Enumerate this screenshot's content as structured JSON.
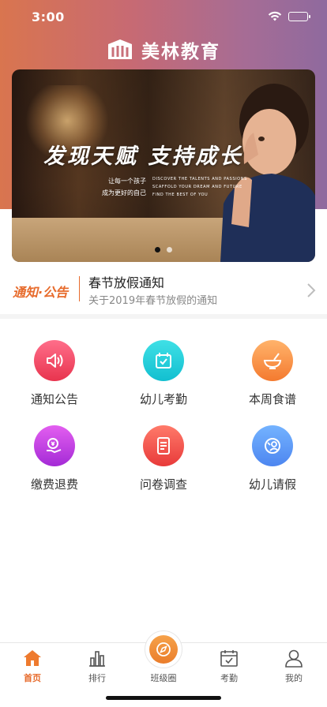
{
  "status_bar": {
    "time": "3:00"
  },
  "brand": {
    "name": "美林教育"
  },
  "banner": {
    "title": "发现天赋 支持成长",
    "subtitle_cn": [
      "让每一个孩子",
      "成为更好的自己"
    ],
    "subtitle_en": [
      "DISCOVER THE TALENTS AND PASSIONS",
      "SCAFFOLD YOUR DREAM AND FUTURE",
      "FIND THE BEST OF YOU"
    ],
    "page_count": 2,
    "active_page": 1
  },
  "notice": {
    "label": "通知·公告",
    "title": "春节放假通知",
    "description": "关于2019年春节放假的通知"
  },
  "features": [
    {
      "label": "通知公告",
      "icon": "speaker-icon",
      "color_from": "#ff6e8a",
      "color_to": "#e8344e"
    },
    {
      "label": "幼儿考勤",
      "icon": "calendar-check-icon",
      "color_from": "#3fe0e6",
      "color_to": "#12bfd0"
    },
    {
      "label": "本周食谱",
      "icon": "bowl-icon",
      "color_from": "#ffb36b",
      "color_to": "#f47a2f"
    },
    {
      "label": "缴费退费",
      "icon": "payment-icon",
      "color_from": "#e35ff0",
      "color_to": "#a42bd6"
    },
    {
      "label": "问卷调查",
      "icon": "document-icon",
      "color_from": "#ff7a6a",
      "color_to": "#e83a3a"
    },
    {
      "label": "幼儿请假",
      "icon": "leave-icon",
      "color_from": "#74b3ff",
      "color_to": "#4d86f0"
    }
  ],
  "tabbar": {
    "tabs": [
      {
        "label": "首页",
        "icon": "home-icon",
        "active": true
      },
      {
        "label": "排行",
        "icon": "ranking-icon",
        "active": false
      },
      {
        "label": "班级圈",
        "icon": "compass-icon",
        "active": false
      },
      {
        "label": "考勤",
        "icon": "calendar-icon",
        "active": false
      },
      {
        "label": "我的",
        "icon": "profile-icon",
        "active": false
      }
    ]
  },
  "colors": {
    "accent": "#e76b2c",
    "header_start": "#d9754f",
    "header_end": "#8f6a9e"
  }
}
